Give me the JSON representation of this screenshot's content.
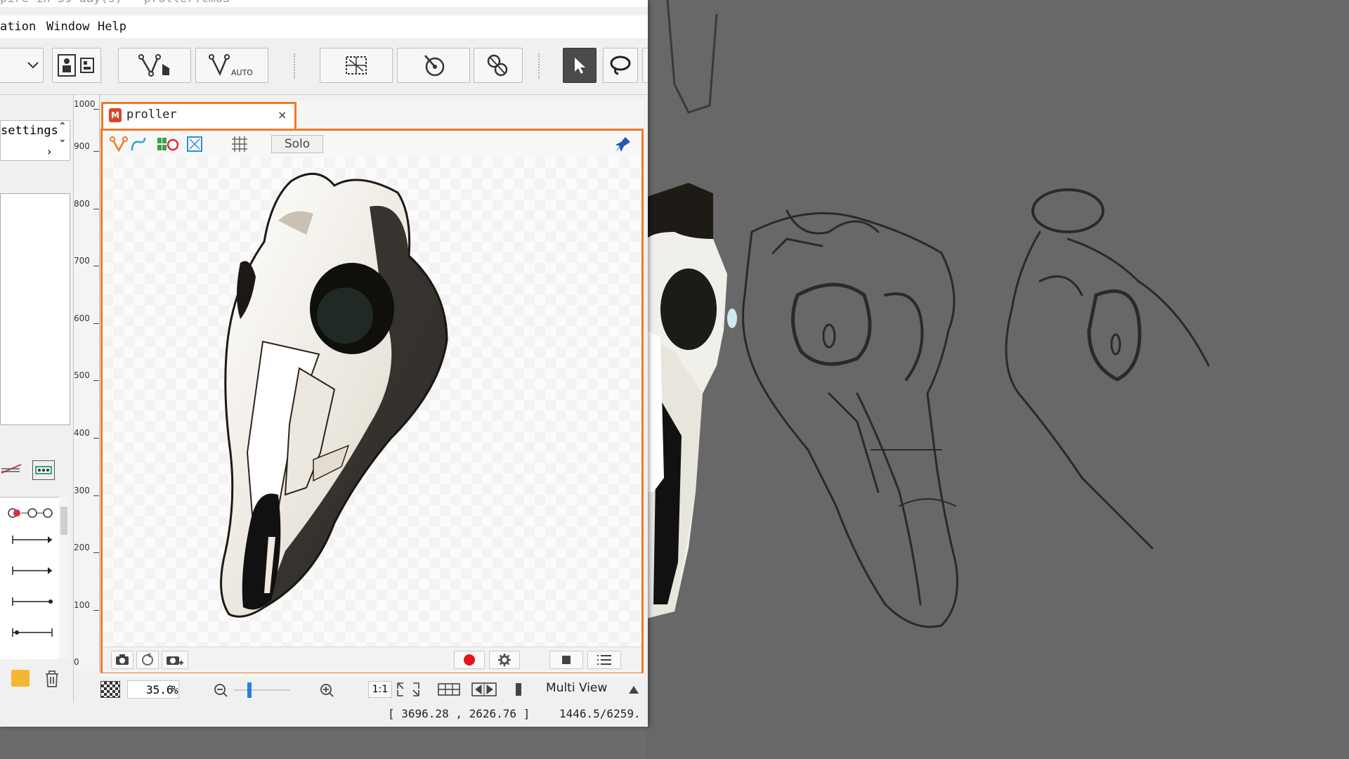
{
  "window": {
    "title": "pire in 39 day(s) - proller.cmo3"
  },
  "menu": {
    "items": [
      "ation",
      "Window",
      "Help"
    ]
  },
  "left_panel": {
    "settings_label": "settings"
  },
  "ruler": {
    "ticks": [
      "1000",
      "900",
      "800",
      "700",
      "600",
      "500",
      "400",
      "300",
      "200",
      "100",
      "0"
    ]
  },
  "document": {
    "tab_title": "proller",
    "tab_close": "×",
    "solo_label": "Solo"
  },
  "zoom": {
    "value": "35.6",
    "unit": "%",
    "one_to_one": "1:1"
  },
  "view": {
    "multi_view_label": "Multi View"
  },
  "status": {
    "coordinates": "[ 3696.28 , 2626.76 ]",
    "memory": "1446.5/6259."
  },
  "colors": {
    "accent": "#f07a2a",
    "record": "#e8141a",
    "brand_icon": "#d9452b"
  }
}
